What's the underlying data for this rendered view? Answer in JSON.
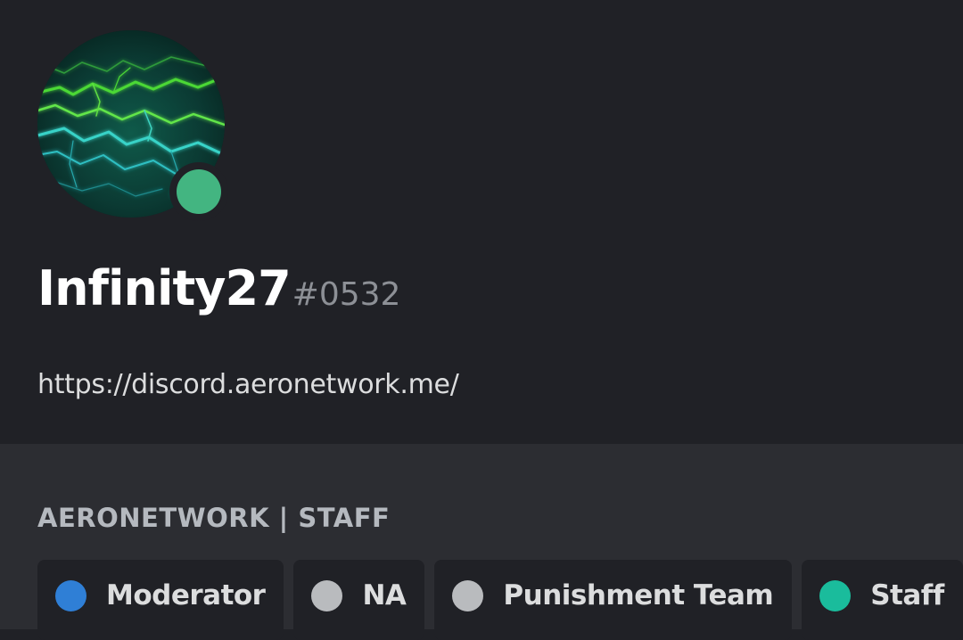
{
  "profile": {
    "username": "Infinity27",
    "discriminator": "#0532",
    "bio": "https://discord.aeronetwork.me/",
    "status_color": "#43b581",
    "avatar_icon": "green-lightning-avatar"
  },
  "roles_section": {
    "title": "AERONETWORK | STAFF",
    "roles": [
      {
        "label": "Moderator",
        "color": "#2f7fd6"
      },
      {
        "label": "NA",
        "color": "#b9bbbe"
      },
      {
        "label": "Punishment Team",
        "color": "#b9bbbe"
      },
      {
        "label": "Staff",
        "color": "#1abc9c"
      }
    ]
  },
  "theme": {
    "header_bg": "#202126",
    "panel_bg": "#2c2d32"
  }
}
